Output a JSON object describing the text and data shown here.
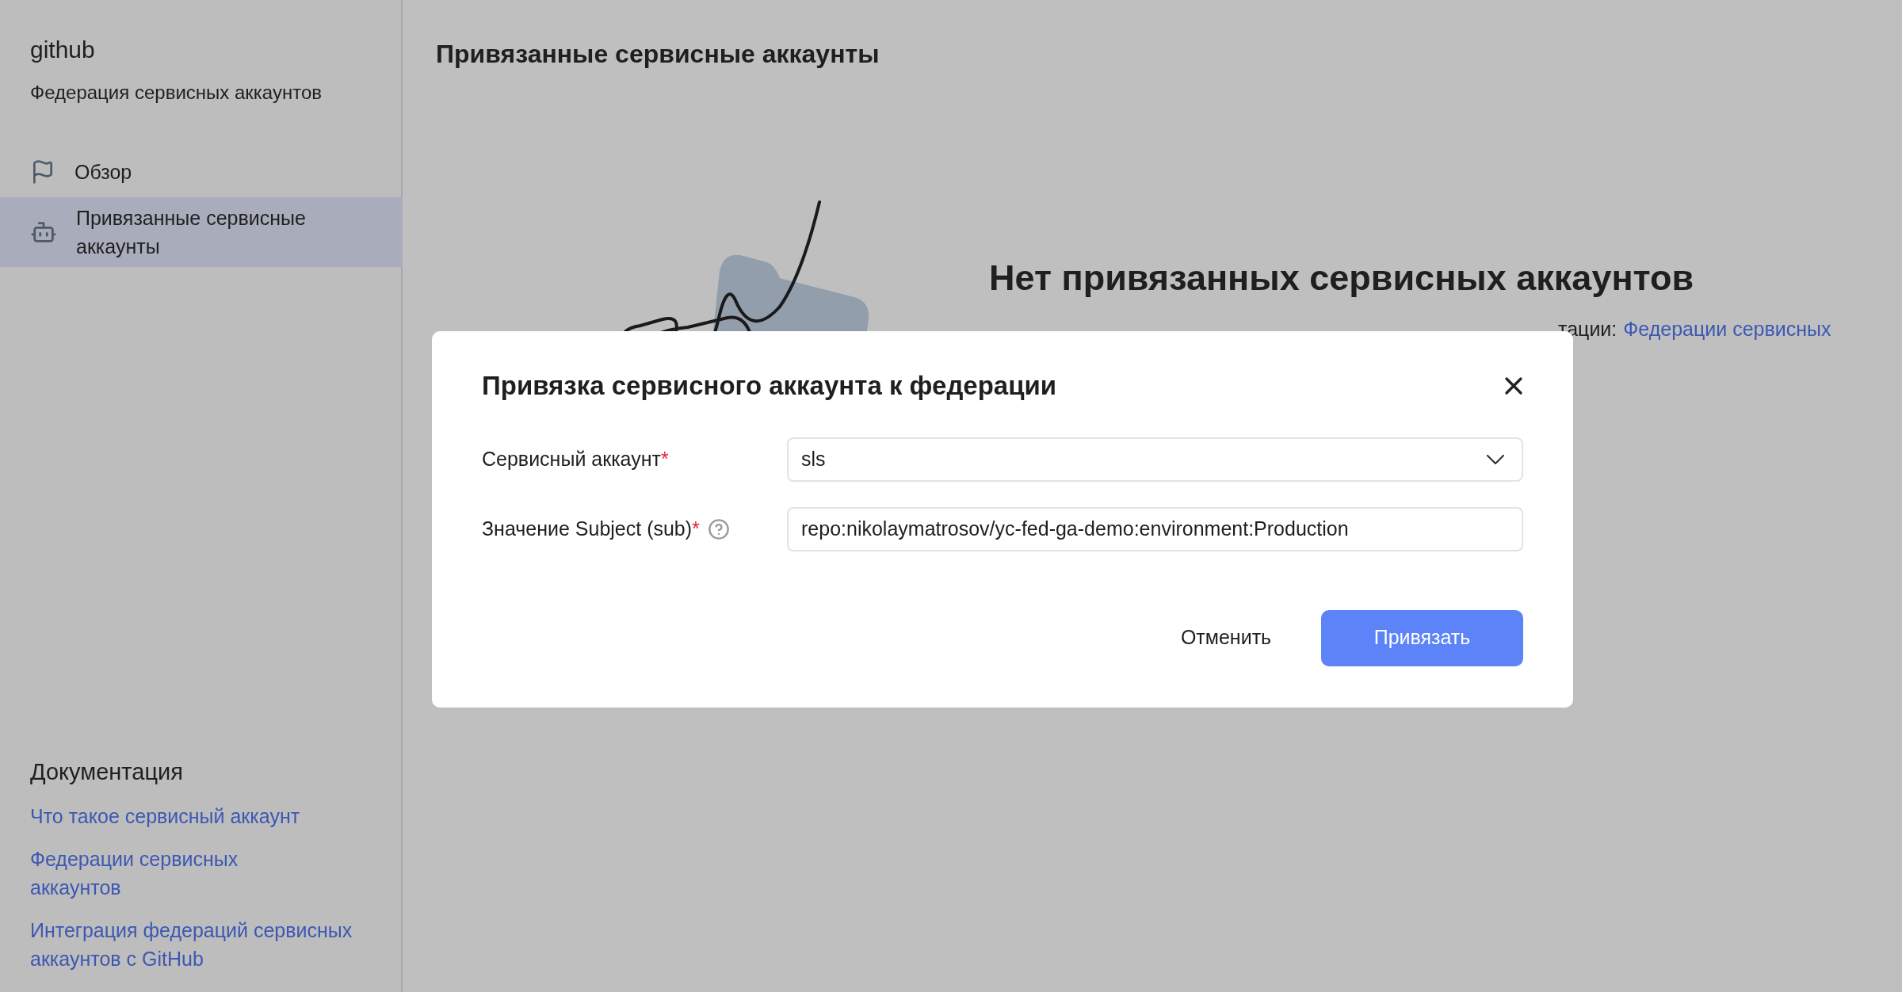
{
  "sidebar": {
    "title": "github",
    "subtitle": "Федерация сервисных аккаунтов",
    "items": [
      {
        "label": "Обзор",
        "selected": false
      },
      {
        "label": "Привязанные сервисные аккаунты",
        "selected": true
      }
    ],
    "docs": {
      "heading": "Документация",
      "links": [
        "Что такое сервисный аккаунт",
        "Федерации сервисных аккаунтов",
        "Интеграция федераций сервисных аккаунтов с GitHub"
      ]
    }
  },
  "page": {
    "title": "Привязанные сервисные аккаунты",
    "empty_state": {
      "heading": "Нет привязанных сервисных аккаунтов",
      "description_visible": "тации:",
      "link": "Федерации сервисных"
    }
  },
  "dialog": {
    "title": "Привязка сервисного аккаунта к федерации",
    "fields": [
      {
        "kind": "select",
        "label": "Сервисный аккаунт",
        "required_mark": "*",
        "help": false,
        "value": "sls"
      },
      {
        "kind": "text",
        "label": "Значение Subject (sub)",
        "required_mark": "*",
        "help": true,
        "value": "repo:nikolaymatrosov/yc-fed-ga-demo:environment:Production"
      }
    ],
    "buttons": [
      {
        "kind": "secondary",
        "label": "Отменить"
      },
      {
        "kind": "primary",
        "label": "Привязать"
      }
    ]
  }
}
